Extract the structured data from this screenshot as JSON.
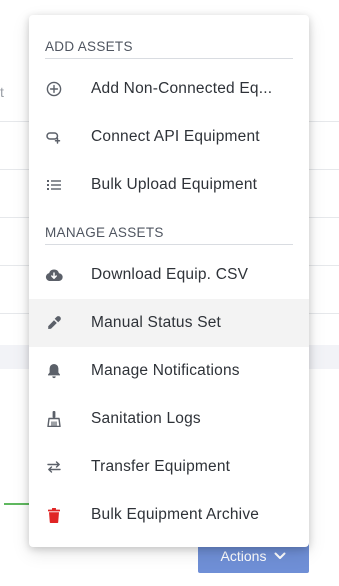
{
  "background": {
    "stub_text": "t"
  },
  "menu": {
    "sections": [
      {
        "title": "ADD ASSETS",
        "items": [
          {
            "label": "Add Non-Connected Eq...",
            "icon": "add-circle-icon"
          },
          {
            "label": "Connect API Equipment",
            "icon": "cloud-link-icon"
          },
          {
            "label": "Bulk Upload Equipment",
            "icon": "list-icon"
          }
        ]
      },
      {
        "title": "MANAGE ASSETS",
        "items": [
          {
            "label": "Download Equip. CSV",
            "icon": "cloud-download-icon"
          },
          {
            "label": "Manual Status Set",
            "icon": "eyedropper-icon",
            "hovered": true
          },
          {
            "label": "Manage Notifications",
            "icon": "bell-icon"
          },
          {
            "label": "Sanitation Logs",
            "icon": "broom-icon"
          },
          {
            "label": "Transfer Equipment",
            "icon": "transfer-arrows-icon"
          },
          {
            "label": "Bulk Equipment Archive",
            "icon": "trash-icon",
            "color": "#e02424"
          }
        ]
      }
    ]
  },
  "actions_button": {
    "label": "Actions",
    "icon": "chevron-down-icon",
    "color": "#6f8fd6"
  },
  "colors": {
    "icon": "#5b6069",
    "text": "#2e3238",
    "header": "#4f5560",
    "hover_bg": "#f3f3f3",
    "danger": "#e02424"
  }
}
